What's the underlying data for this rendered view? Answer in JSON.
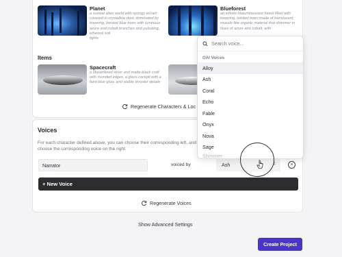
{
  "characters": {
    "cards": [
      {
        "title": "Planet",
        "description": "a surreal alien world with spongy terrain covered in crystalline dust, dominated by towering, twisted blue trees with luminous azure and cobalt branches and pulsating, ethereal soil",
        "description_tail": "lights"
      },
      {
        "title": "Blueforest",
        "description": "an infinite bioluminescent forest filled with towering, twisted trees made of translucent, muscle-like organic material that shimmer in hues of azure and cobalt, with",
        "description_tail": ""
      }
    ]
  },
  "items": {
    "label": "Items",
    "cards": [
      {
        "title": "Spacecraft",
        "description": "a streamlined silver and matte black craft with rounded edges, a glass cockpit with a faint blue glow, and visible thruster details"
      }
    ],
    "regenerate_label": "Regenerate Characters & Loc"
  },
  "voices": {
    "title": "Voices",
    "description": "For each character defined above, you can choose their corresponding left, and choose the corresponding voice on the right.",
    "rows": [
      {
        "name": "Narrator",
        "voiced_by_label": "voiced by",
        "voice": "Ash"
      }
    ],
    "new_voice_label": "+ New Voice",
    "regenerate_label": "Regenerate Voices"
  },
  "footer": {
    "advanced_label": "Show Advanced Settings",
    "create_label": "Create Project"
  },
  "dropdown": {
    "placeholder": "Search voice...",
    "group_label": "OAI Voices",
    "options": [
      "Alloy",
      "Ash",
      "Coral",
      "Echo",
      "Fable",
      "Onyx",
      "Nova",
      "Sage"
    ],
    "highlighted": "Alloy",
    "cut_option": "Shimmer"
  },
  "colors": {
    "primary": "#4a35c9",
    "dark_button": "#2c2d31",
    "highlight_row": "#eef0f4"
  },
  "icons": [
    "refresh-icon",
    "search-icon",
    "chevron-updown-icon",
    "close-circle-icon",
    "pointer-hand-icon"
  ]
}
